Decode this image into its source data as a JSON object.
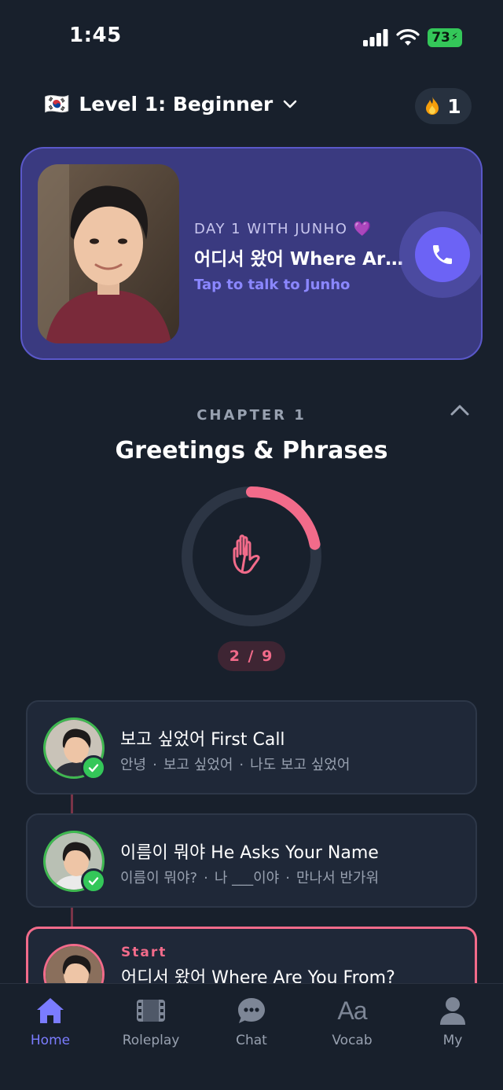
{
  "status_bar": {
    "time": "1:45",
    "battery": "73"
  },
  "header": {
    "flag": "🇰🇷",
    "level": "Level 1: Beginner",
    "streak_count": "1"
  },
  "call_card": {
    "day_label": "DAY 1 WITH JUNHO 💜",
    "title": "어디서 왔어 Where Are You From?",
    "subtitle": "Tap to talk to Junho"
  },
  "chapter": {
    "label": "CHAPTER 1",
    "title": "Greetings & Phrases",
    "progress_text": "2 / 9",
    "progress_fraction": 0.22
  },
  "lessons": [
    {
      "title": "보고 싶었어 First Call",
      "phrases": [
        "안녕",
        "보고 싶었어",
        "나도 보고 싶었어"
      ],
      "completed": true
    },
    {
      "title": "이름이 뭐야 He Asks Your Name",
      "phrases": [
        "이름이 뭐야?",
        "나 ___이야",
        "만나서 반가워"
      ],
      "completed": true
    },
    {
      "start_label": "Start",
      "title": "어디서 왔어 Where Are You From?",
      "completed": false
    }
  ],
  "tabs": [
    {
      "label": "Home",
      "icon": "home-icon",
      "active": true
    },
    {
      "label": "Roleplay",
      "icon": "film-icon",
      "active": false
    },
    {
      "label": "Chat",
      "icon": "chat-bubble-icon",
      "active": false
    },
    {
      "label": "Vocab",
      "icon": "text-aa-icon",
      "active": false
    },
    {
      "label": "My",
      "icon": "person-icon",
      "active": false
    }
  ],
  "colors": {
    "background": "#18202c",
    "accent_purple": "#6c63f5",
    "accent_pink": "#f26b8a",
    "success_green": "#34c759"
  }
}
